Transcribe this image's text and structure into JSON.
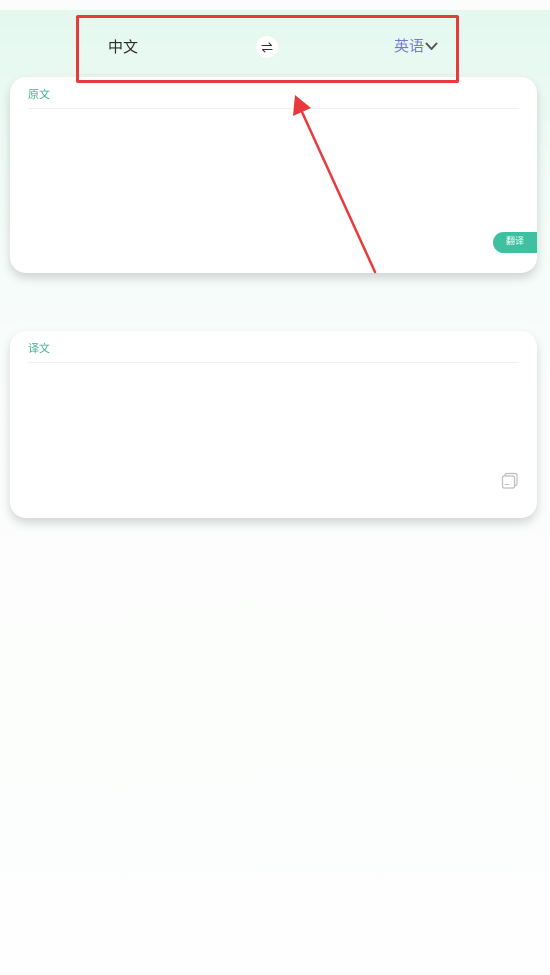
{
  "language_bar": {
    "source_language": "中文",
    "swap_icon": "⇌",
    "target_language": "英语",
    "dropdown_icon": "chevron-down-icon"
  },
  "source_card": {
    "label": "原文",
    "input_value": "",
    "translate_button": "翻译"
  },
  "result_card": {
    "label": "译文",
    "result_text": "",
    "copy_icon": "copy-icon"
  },
  "colors": {
    "accent_green": "#3fc0a0",
    "label_green": "#3fb08f",
    "target_language_purple": "#7879d6",
    "annotation_red": "#e83a3c"
  }
}
